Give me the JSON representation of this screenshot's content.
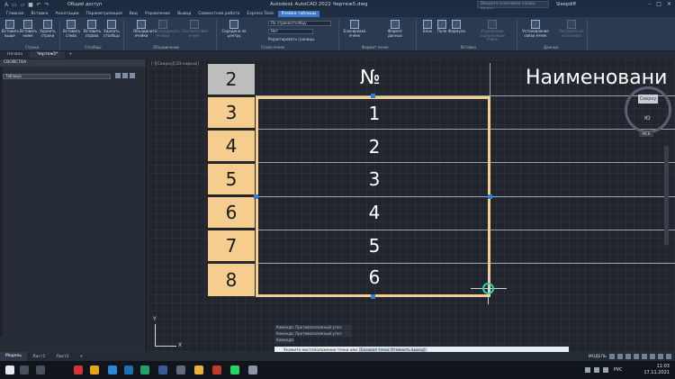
{
  "titlebar": {
    "title": "Autodesk AutoCAD 2022   Чертеж5.dwg",
    "share": "Общий доступ",
    "search_placeholder": "Введите ключевое слово/фразу",
    "user": "Sleepdiff"
  },
  "menu_tabs": [
    "Главная",
    "Вставка",
    "Аннотации",
    "Параметризация",
    "Вид",
    "Управление",
    "Вывод",
    "Совместная работа",
    "Express Tools",
    "Ячейка таблицы"
  ],
  "active_menu_tab": "Ячейка таблицы",
  "ribbon": {
    "buttons": [
      {
        "label": "Вставить выше",
        "dim": false
      },
      {
        "label": "Вставить ниже",
        "dim": false
      },
      {
        "label": "Удалить строки",
        "dim": false
      },
      {
        "label": "Вставить слева",
        "dim": false
      },
      {
        "label": "Вставить справа",
        "dim": false
      },
      {
        "label": "Удалить столбцы",
        "dim": false
      },
      {
        "label": "Объединить ячейки",
        "dim": false
      },
      {
        "label": "Разъединить ячейки",
        "dim": true
      },
      {
        "label": "Соответствие ячеек",
        "dim": true
      },
      {
        "label": "Середина по центру",
        "dim": false
      },
      {
        "label": "Блокировка ячеек",
        "dim": false
      },
      {
        "label": "Формат данных",
        "dim": false
      },
      {
        "label": "Блок",
        "dim": false
      },
      {
        "label": "Поле",
        "dim": false
      },
      {
        "label": "Формула",
        "dim": false
      },
      {
        "label": "Управление содержимым ячеек",
        "dim": true
      },
      {
        "label": "Установление связи ячеек",
        "dim": false
      },
      {
        "label": "Загрузить из источника",
        "dim": true
      }
    ],
    "groups": [
      "Строки",
      "Столбцы",
      "Объединение",
      "Стили ячеек",
      "Формат ячеек",
      "Вставка",
      "Данные"
    ],
    "style_dropdown": "По строке/столбцу",
    "color_dropdown": "Нет",
    "borders_label": "Редактировать границы"
  },
  "doc_tabs": [
    "Начало",
    "Чертеж5*"
  ],
  "properties": {
    "header": "СВОЙСТВА",
    "object_type": "Таблица"
  },
  "canvas": {
    "view_label": "[-][Сверху][2D-каркас]",
    "column_header_number": "№",
    "column_header_name": "Наименовани",
    "row_headers": [
      "2",
      "3",
      "4",
      "5",
      "6",
      "7",
      "8"
    ],
    "cell_values": [
      "1",
      "2",
      "3",
      "4",
      "5",
      "6"
    ],
    "viewcube_face": "Сверху",
    "viewcube_south": "Ю",
    "wcs": "МСК",
    "ucs_x": "X",
    "ucs_y": "Y"
  },
  "command": {
    "history": [
      "Команда: Противоположный угол:",
      "Команда: Противоположный угол:",
      "Команда:"
    ],
    "prompt": "Укажите местоположение точки или",
    "keywords": "[Базовая точка Отменить выход]:"
  },
  "layout_tabs": [
    "Модель",
    "Лист1",
    "Лист2"
  ],
  "status": {
    "mode": "МОДЕЛЬ"
  },
  "taskbar": {
    "lang": "РУС",
    "time": "11:03",
    "date": "17.11.2021"
  },
  "colors": {
    "row_fill": "#f5cd8e",
    "header_fill": "#bdbdbd",
    "grip": "#2f7fd6",
    "accent_tab": "#3a79c7"
  }
}
